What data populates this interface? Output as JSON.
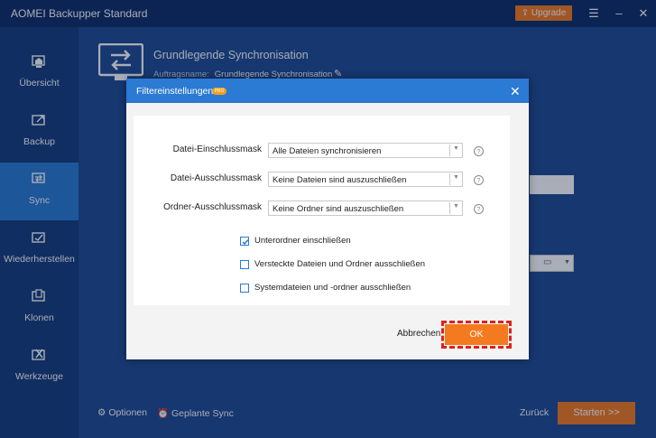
{
  "app": {
    "title": "AOMEI Backupper Standard",
    "upgrade_label": "Upgrade"
  },
  "sidebar": {
    "items": [
      {
        "label": "Übersicht"
      },
      {
        "label": "Backup"
      },
      {
        "label": "Sync"
      },
      {
        "label": "Wiederherstellen"
      },
      {
        "label": "Klonen"
      },
      {
        "label": "Werkzeuge"
      }
    ],
    "active": "Sync"
  },
  "page": {
    "title": "Grundlegende Synchronisation",
    "task_label": "Auftragsname:",
    "task_value": "Grundlegende Synchronisation"
  },
  "footer": {
    "options_label": "Optionen",
    "schedule_label": "Geplante Sync",
    "back_label": "Zurück",
    "start_label": "Starten >>"
  },
  "dialog": {
    "title": "Filtereinstellungen",
    "badge": "PRO",
    "rows": [
      {
        "label": "Datei-Einschlussmask",
        "value": "Alle Dateien synchronisieren"
      },
      {
        "label": "Datei-Ausschlussmask",
        "value": "Keine Dateien sind auszuschließen"
      },
      {
        "label": "Ordner-Ausschlussmask",
        "value": "Keine Ordner sind auszuschließen"
      }
    ],
    "checkboxes": [
      {
        "label": "Unterordner einschließen",
        "checked": true
      },
      {
        "label": "Versteckte Dateien und Ordner ausschließen",
        "checked": false
      },
      {
        "label": "Systemdateien und -ordner ausschließen",
        "checked": false
      }
    ],
    "cancel_label": "Abbrechen",
    "ok_label": "OK"
  },
  "colors": {
    "accent": "#f47a20",
    "primary": "#2b7ad3",
    "highlight": "#e0201a"
  }
}
